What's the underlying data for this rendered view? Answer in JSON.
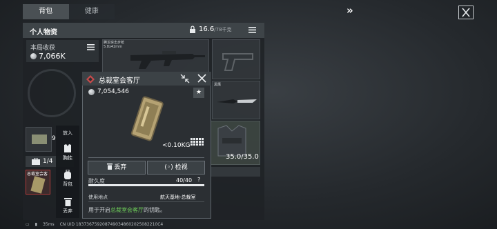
{
  "tabs": [
    {
      "label": "背包"
    },
    {
      "label": "健康"
    }
  ],
  "panel": {
    "title": "个人物资",
    "weight_value": "16.6",
    "weight_max": "/78千克"
  },
  "earnings": {
    "label": "本局收获",
    "value": "7,066K"
  },
  "slots": {
    "gun_name": "腾龙突击步枪",
    "gun_ammo": "5.8x42mm",
    "knife_name": "黑鹰",
    "vest_value": "35.0/35.0",
    "small_count": "9",
    "pouch_label": "1/4",
    "card_label": "总裁室会客"
  },
  "actions": [
    {
      "label": "放入"
    },
    {
      "label": "胸挂"
    },
    {
      "label": "背包"
    },
    {
      "label": "丢弃"
    }
  ],
  "popup": {
    "title": "总裁室会客厅",
    "price": "7,054,546",
    "fav_icon": "★",
    "weight": "<0.10KG",
    "discard_label": "丢弃",
    "inspect_label": "检视",
    "durability_label": "耐久度",
    "durability_value": "40/40",
    "durability_fraction": 1.0,
    "help": "?",
    "location_label": "使用地点",
    "location_value": "航天基地-总裁室",
    "usage_prefix": "用于开启",
    "usage_highlight": "总裁室会客厅",
    "usage_suffix": "的钥匙。"
  },
  "status": {
    "ping": "35ms",
    "uid": "CN UID 1837367592087490348602025082210C4"
  },
  "colors": {
    "highlight": "#6fcf5a",
    "card_slot_border": "#b23b3b"
  }
}
